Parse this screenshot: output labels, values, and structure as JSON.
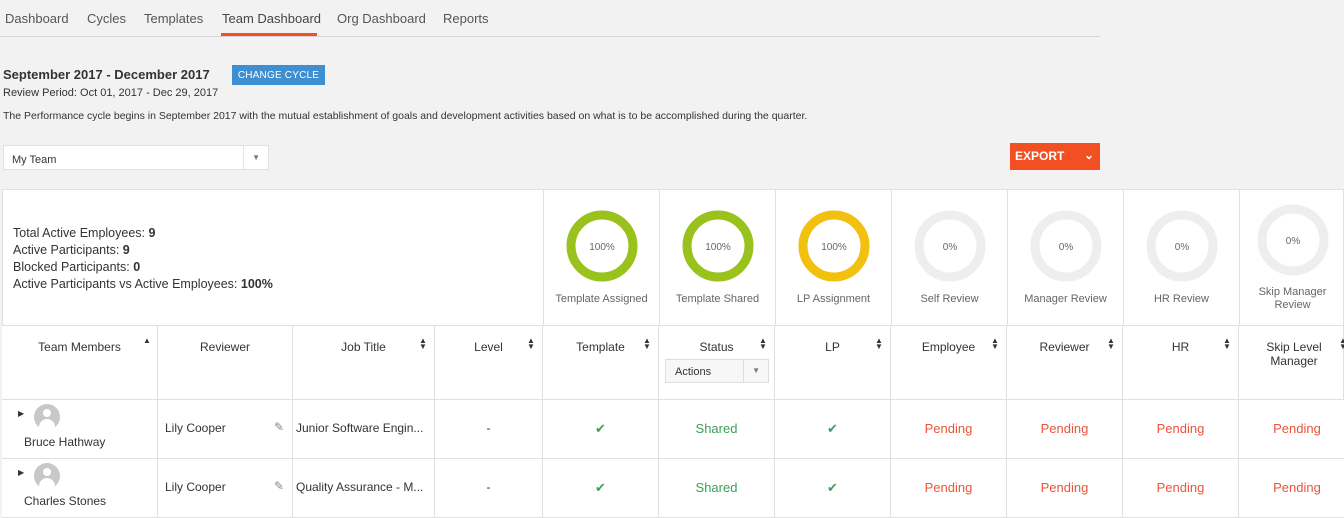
{
  "nav": {
    "items": [
      "Dashboard",
      "Cycles",
      "Templates",
      "Team Dashboard",
      "Org Dashboard",
      "Reports"
    ],
    "active": "Team Dashboard"
  },
  "cycle": {
    "title": "September 2017 - December 2017",
    "change_label": "CHANGE CYCLE",
    "review_period": "Review Period: Oct 01, 2017 - Dec 29, 2017",
    "description": "The Performance cycle begins in September 2017 with the mutual establishment of goals and development activities based on what is to be accomplished during the quarter."
  },
  "team_select": {
    "value": "My Team"
  },
  "export_label": "EXPORT",
  "stats": {
    "total_label": "Total Active Employees: ",
    "total": "9",
    "active_label": "Active Participants: ",
    "active": "9",
    "blocked_label": "Blocked Participants: ",
    "blocked": "0",
    "ratio_label": "Active Participants vs Active Employees: ",
    "ratio": "100%"
  },
  "rings": [
    {
      "label": "Template Assigned",
      "value": "100%",
      "fraction": 1.0,
      "color": "#9ac21d"
    },
    {
      "label": "Template Shared",
      "value": "100%",
      "fraction": 1.0,
      "color": "#9ac21d"
    },
    {
      "label": "LP Assignment",
      "value": "100%",
      "fraction": 1.0,
      "color": "#f2c10f"
    },
    {
      "label": "Self Review",
      "value": "0%",
      "fraction": 0.0,
      "color": "#eeeeee"
    },
    {
      "label": "Manager Review",
      "value": "0%",
      "fraction": 0.0,
      "color": "#eeeeee"
    },
    {
      "label": "HR Review",
      "value": "0%",
      "fraction": 0.0,
      "color": "#eeeeee"
    },
    {
      "label": "Skip Manager Review",
      "value": "0%",
      "fraction": 0.0,
      "color": "#eeeeee"
    }
  ],
  "table": {
    "headers": {
      "team_members": "Team Members",
      "reviewer": "Reviewer",
      "job_title": "Job Title",
      "level": "Level",
      "template": "Template",
      "status": "Status",
      "lp": "LP",
      "employee": "Employee",
      "reviewer2": "Reviewer",
      "hr": "HR",
      "skip": "Skip Level Manager"
    },
    "actions_placeholder": "Actions",
    "rows": [
      {
        "name": "Bruce Hathway",
        "reviewer": "Lily Cooper",
        "job_title": "Junior Software Engin...",
        "level": "-",
        "template": "✔",
        "status": "Shared",
        "lp": "✔",
        "employee": "Pending",
        "reviewer_status": "Pending",
        "hr": "Pending",
        "skip": "Pending"
      },
      {
        "name": "Charles Stones",
        "reviewer": "Lily Cooper",
        "job_title": "Quality Assurance - M...",
        "level": "-",
        "template": "✔",
        "status": "Shared",
        "lp": "✔",
        "employee": "Pending",
        "reviewer_status": "Pending",
        "hr": "Pending",
        "skip": "Pending"
      }
    ]
  }
}
